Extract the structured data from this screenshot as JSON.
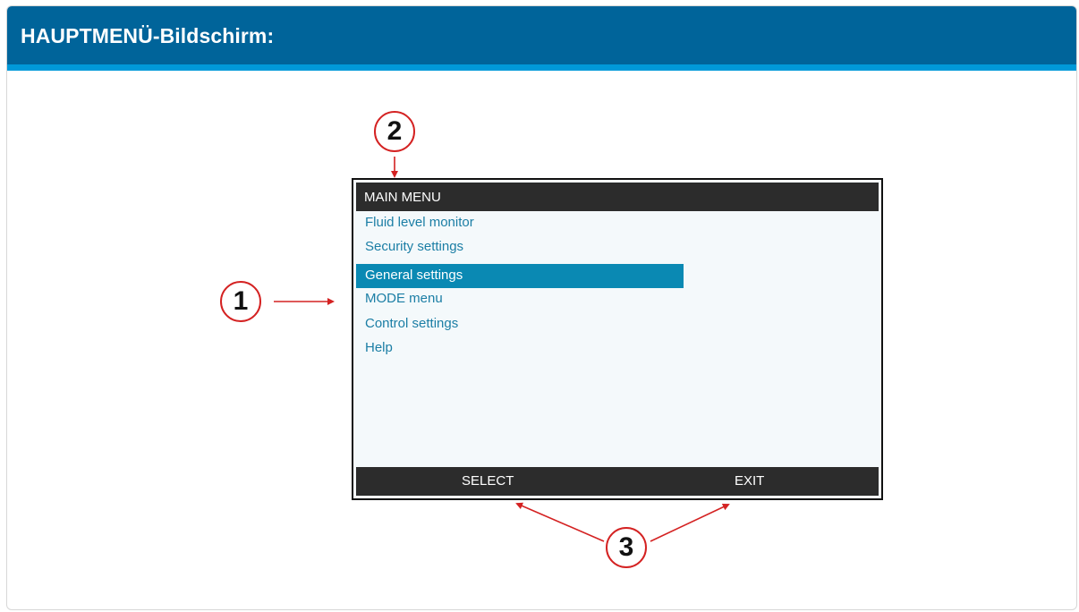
{
  "page": {
    "title": "HAUPTMENÜ-Bildschirm:"
  },
  "device_screen": {
    "title": "MAIN MENU",
    "menu_items": [
      {
        "label": "Fluid level monitor",
        "selected": false
      },
      {
        "label": "Security settings",
        "selected": false
      },
      {
        "label": "General settings",
        "selected": true
      },
      {
        "label": "MODE menu",
        "selected": false
      },
      {
        "label": "Control settings",
        "selected": false
      },
      {
        "label": "Help",
        "selected": false
      }
    ],
    "softkeys": {
      "select": "SELECT",
      "exit": "EXIT"
    }
  },
  "callouts": [
    "1",
    "2",
    "3"
  ],
  "colors": {
    "header": "#00649a",
    "header_stripe": "#0099d9",
    "highlight": "#0a89b3",
    "menu_text": "#1b7ea5",
    "annotation": "#d42222"
  }
}
